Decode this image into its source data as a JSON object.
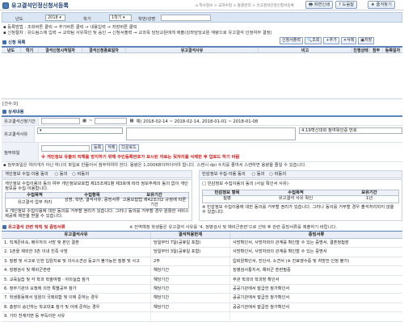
{
  "header": {
    "title": "유고결석인정신청서등록",
    "breadcrumb": [
      "학사정보",
      "교과수업",
      "출결관리",
      "유고결석인정신청서등록"
    ],
    "buttons": [
      "화면인쇄",
      "도움말",
      "즐겨찾기"
    ]
  },
  "search": {
    "year_label": "년도",
    "year_value": "2018",
    "term_label": "학기",
    "term_value": "1학기",
    "student_label": "학번/성명"
  },
  "notes": [
    "▪ 등록방법 : 조회버튼 클릭 → 추가버튼 클릭 → 내용입력 → 저장버튼 클릭",
    "▪ 신청절차 : 유드림스에 입력 → 교학팀 사유확인 및 승인 → 신청서출력 → 교과목 담당교원에게 제출(강좌담당교원 재량으로 유고결석 인정여부 결정)"
  ],
  "list": {
    "section_title": "신청 목록",
    "actions": [
      "신청서출력",
      "조회",
      "추가",
      "삭제",
      "저장"
    ],
    "columns": [
      "년도",
      "학기",
      "결석신청시작일자",
      "결석신청종료일자",
      "유고결석사유",
      "비고",
      "진행상태",
      "첨부",
      "등록일자"
    ],
    "count": "[건수:0]"
  },
  "detail": {
    "section_title": "상세내용",
    "period_label": "유고결석신청기간",
    "period_example": "예) 2018-02-14 ~ 2018-02-14,   2018-01-01 ~ 2018-01-08",
    "reason_label": "유고결석사유",
    "attach_label": "첨부파일",
    "other_reason_hint": "4.19혁신대회 참여확인증 번호",
    "register_btn": "등록",
    "delete_btn": "삭제",
    "download_btn": "다운로드",
    "warning": "※ 개인정보 유출의 피해를 방지하기 위해 주민등록번호가 표시된 자료는 뒷자리를 삭제한 후 업로드 하기 바람",
    "attach_note": "▪ 첨부파일은 여러개가 아닌 하나의 파일로 만들어서 첨부하여야 한다. 용량은 1,000KB이하이어야 합니다. 스캔시 dpi 수치를 줄여서 스캔하면 용량을 줄일 수 있습니다."
  },
  "consent": {
    "left_title": "개인정보 수집·이용 동의",
    "left_options": [
      "동의",
      "비동의"
    ],
    "left_desc": "개인정보 수집이용의 동의 여부 개인정보보호법 제15조제1항 제3호에 따라 정보주체의 동의 없이 개인정보를 수집·이용합니다.",
    "left_table": {
      "headers": [
        "수집목적",
        "수집항목",
        "보유기간"
      ],
      "row": [
        "유고결석 업무 처리",
        "성명, 학번, 결석사유, 증빙서류",
        "고용보험법 제42조의2 규정에 따른 기간"
      ]
    },
    "left_foot": "※ 개인정보 수집이용에 대한 동의를 거부할 권리가 있습니다. 그러나 동의를 거부할 경우 원활한 서비스 제공에 제한을 받을 수 있습니다.",
    "right_title": "민감정보 수집·이용 동의",
    "right_options": [
      "동의",
      "비동의"
    ],
    "right_desc": "□ 민감정보 수집이용의 동의 (사실 확인서 사유)",
    "right_table": {
      "headers": [
        "민감정보 항목",
        "수집목적",
        "보유기간"
      ],
      "row": [
        "질병",
        "유고결석 사유 확인",
        "1년"
      ]
    },
    "right_foot": "※ 민감정보 수집이용에 대한 동의를 거부할 권리가 있습니다. 그러나 동의를 거부할 경우 출석처리되지 않을 수 있습니다."
  },
  "rules": {
    "section_title": "유고결석 관련 학칙 및 증빙서류",
    "note": "※ 전역예정 학생들은 유고결석 사유를 '4. 정병검사 및 예비군훈련'으로 선택 후 관련 증빙서류를 제출하기 바랍니다.",
    "headers": [
      "유고결석사유",
      "결석허용한계",
      "증빙서류"
    ],
    "rows": [
      [
        "1. 직계존비속, 배우자의 사망 및 본인 결혼",
        "당일부터 7일(공휴일 포함)",
        "사망확인서, 사망자와의 관계를 확인할 수 있는 증명서, 결혼청첩장"
      ],
      [
        "2. 1촌을 제외한 3촌 이내 친족 사망",
        "당일부터 3일(공휴일 포함)",
        "사망확인서, 사망자와의 관계를 확인할 수 있는 증명서"
      ],
      [
        "3. 질병 및 사고로 인한 입원치료 및 의사소견상 등교가 불가능한 질병 및 사고",
        "2주",
        "입퇴원확인서, 진단서, 소견서 (※ 진료영수증 및 처방전 인정 불가)"
      ],
      [
        "4. 징병검사 및 예비군훈련",
        "해당기간",
        "징병검사통지서, 예비군 훈련필증"
      ],
      [
        "5. 교육실습 및 각 학과 학술여행 · 야외실습 참가",
        "해당기간",
        "주관 학과의 학과장 확인서"
      ],
      [
        "6. 정부기관의 요청에 의한 특별공무 참가",
        "해당기간",
        "공공기관에서 발급한 참가확인서"
      ],
      [
        "7. 학생활동에서 임원의 국제회합 및 이에 준하는 경우",
        "해당기간",
        "공공기관에서 발급한 참가확인서"
      ],
      [
        "8. 총장이 승인하는 학교대표 참가 및 이에 준하는 경우",
        "해당기간",
        "공공기관에서 발급한 참가확인서"
      ],
      [
        "9. 기타 천재지변 등 부득이한 사유",
        "",
        ""
      ]
    ]
  }
}
